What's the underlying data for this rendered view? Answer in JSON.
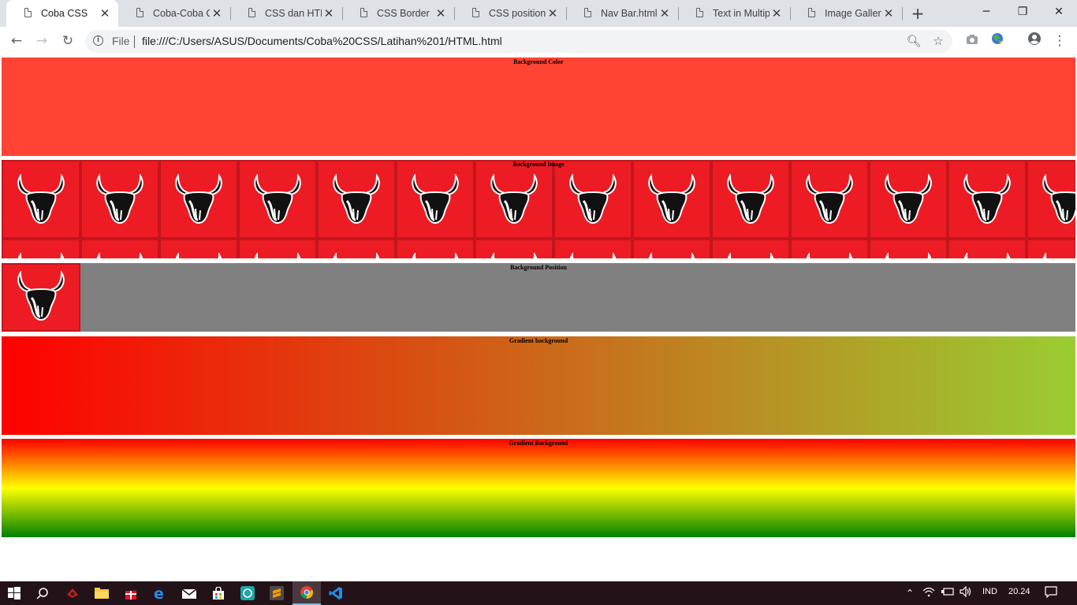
{
  "browser": {
    "tabs": [
      {
        "title": "Coba CSS",
        "active": true
      },
      {
        "title": "Coba-Coba CS",
        "active": false
      },
      {
        "title": "CSS dan HTML",
        "active": false
      },
      {
        "title": "CSS Border",
        "active": false
      },
      {
        "title": "CSS position d",
        "active": false
      },
      {
        "title": "Nav Bar.html",
        "active": false
      },
      {
        "title": "Text in Multipl",
        "active": false
      },
      {
        "title": "Image Gallery",
        "active": false
      }
    ],
    "address_bar": {
      "scheme_label": "File",
      "url": "file:///C:/Users/ASUS/Documents/Coba%20CSS/Latihan%201/HTML.html"
    }
  },
  "page": {
    "sections": [
      {
        "caption": "Background Color",
        "background": "#ff4433"
      },
      {
        "caption": "Background Image",
        "background": "#ed1c24"
      },
      {
        "caption": "Background Position",
        "background": "#808080"
      },
      {
        "caption": "Gradient background",
        "background": "linear red to yellowgreen"
      },
      {
        "caption": "Gradient Background",
        "background": "vertical red-yellow-green"
      }
    ]
  },
  "taskbar": {
    "language": "IND",
    "time": "20.24",
    "apps": [
      "start-icon",
      "search-icon",
      "game-icon",
      "file-explorer-icon",
      "gift-icon",
      "edge-icon",
      "mail-icon",
      "store-icon",
      "whatsapp-icon",
      "sublime-text-icon",
      "chrome-icon",
      "vscode-icon"
    ]
  },
  "colors": {
    "tab_strip": "#dee1e6",
    "taskbar": "#241219",
    "accent": "#76b9ed"
  }
}
